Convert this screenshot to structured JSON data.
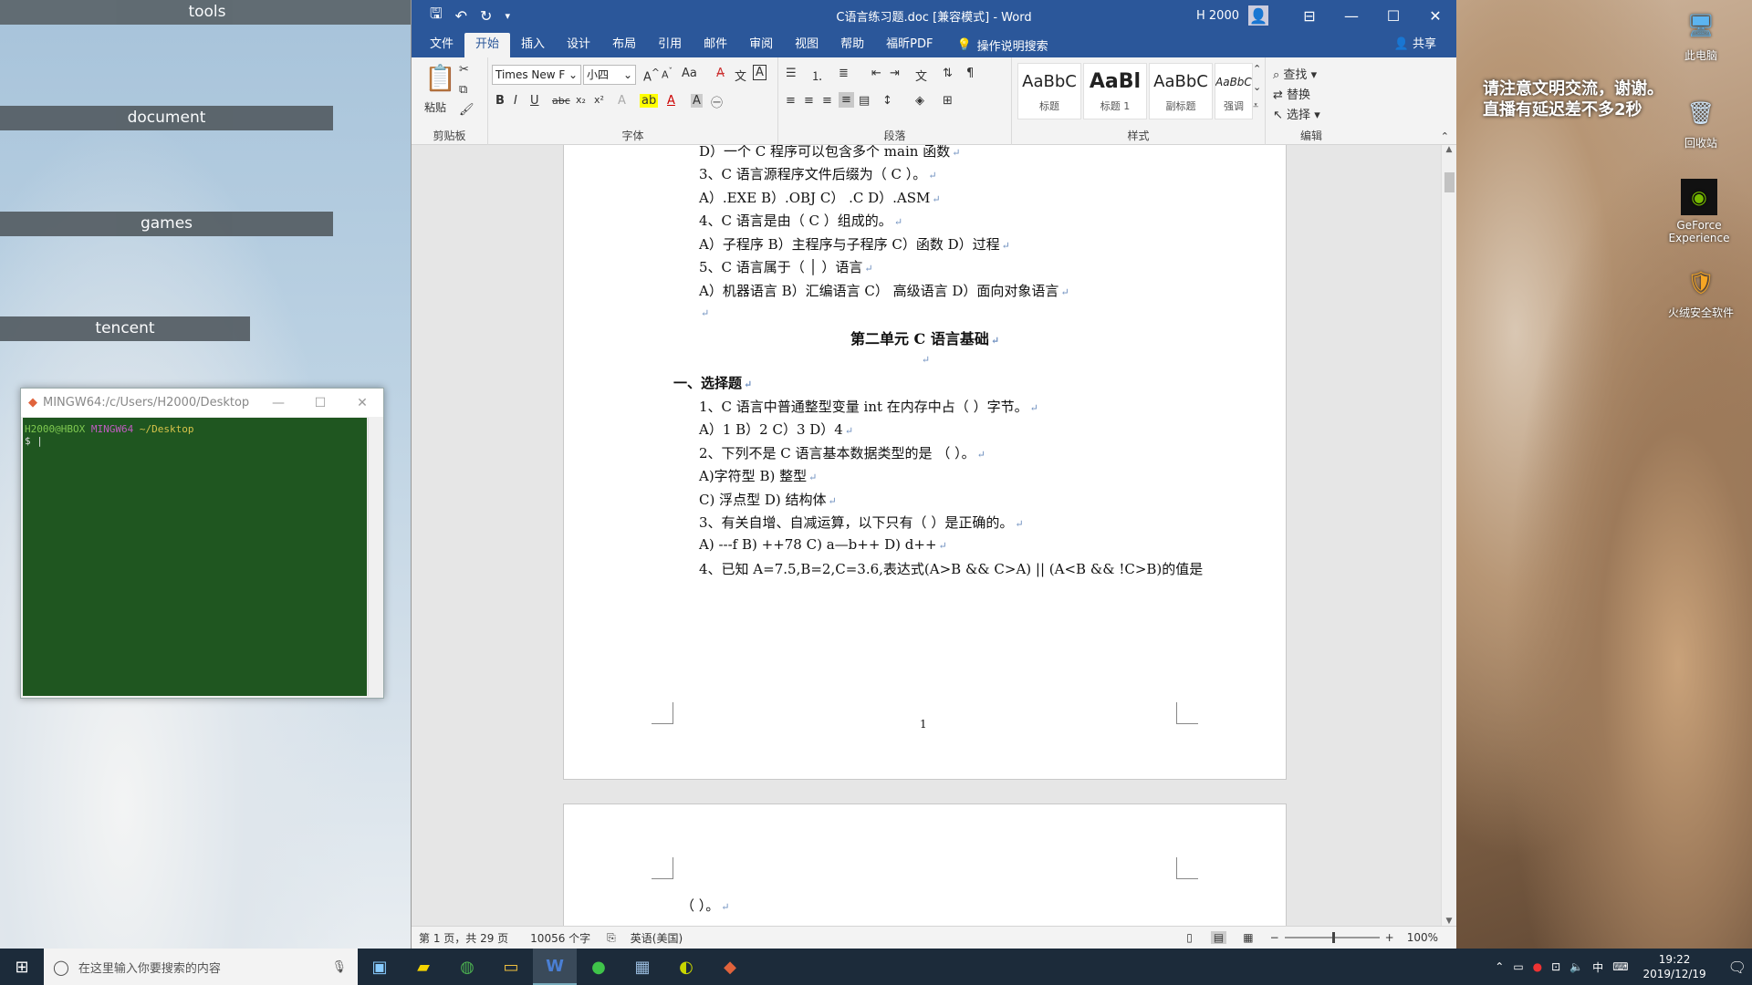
{
  "desktop": {
    "folders": [
      "tools",
      "document",
      "games",
      "tencent"
    ],
    "icons": [
      {
        "label": "此电脑",
        "icon": "computer-icon"
      },
      {
        "label": "回收站",
        "icon": "recycle-bin-icon"
      },
      {
        "label": "GeForce Experience",
        "icon": "nvidia-icon"
      },
      {
        "label": "火绒安全软件",
        "icon": "shield-icon"
      }
    ],
    "overlay_text": [
      "请注意文明交流，谢谢。",
      "直播有延迟差不多2秒"
    ]
  },
  "terminal": {
    "title": "MINGW64:/c/Users/H2000/Desktop",
    "prompt_user": "H2000@HBOX",
    "prompt_env": "MINGW64",
    "prompt_path": "~/Desktop",
    "prompt_symbol": "$"
  },
  "word": {
    "title": "C语言练习题.doc [兼容模式] - Word",
    "user": "H 2000",
    "tabs": [
      "文件",
      "开始",
      "插入",
      "设计",
      "布局",
      "引用",
      "邮件",
      "审阅",
      "视图",
      "帮助",
      "福昕PDF"
    ],
    "active_tab": "开始",
    "tell_me": "操作说明搜索",
    "share": "共享",
    "ribbon": {
      "clipboard": {
        "paste": "粘贴",
        "group": "剪贴板"
      },
      "font": {
        "name": "Times New F",
        "size": "小四",
        "group": "字体",
        "aa": "Aa",
        "grow": "A^",
        "shrink": "A^"
      },
      "paragraph": {
        "group": "段落"
      },
      "styles": {
        "group": "样式",
        "tiles": [
          {
            "sample": "AaBbC",
            "name": "标题"
          },
          {
            "sample": "AaBl",
            "name": "标题 1"
          },
          {
            "sample": "AaBbC",
            "name": "副标题"
          },
          {
            "sample": "AaBbCcDı",
            "name": "强调"
          }
        ]
      },
      "editing": {
        "group": "编辑",
        "find": "查找",
        "replace": "替换",
        "select": "选择"
      }
    },
    "document": {
      "lines": [
        "D）一个 C 程序可以包含多个 main 函数",
        "3、C  语言源程序文件后缀为（   C  ）。",
        "A）.EXE          B）.OBJ                  C）  .C        D）.ASM",
        "4、C 语言是由（  C  ）组成的。",
        "A）子程序       B）主程序与子程序      C）函数     D）过程",
        "5、C 语言属于（   │ ）语言",
        "A）机器语言    B）汇编语言    C）  高级语言     D）面向对象语言",
        "",
        "第二单元      C 语言基础",
        "",
        "一、选择题",
        "1、C 语言中普通整型变量 int 在内存中占（    ）字节。",
        "A）1                B）2                C）3                D）4",
        "2、下列不是 C 语言基本数据类型的是  （    ）。",
        "A)字符型                                    B)  整型",
        "C)  浮点型                                  D)  结构体",
        "3、有关自增、自减运算，以下只有（    ）是正确的。",
        "A) ---f            B) ++78            C) a—b++              D) d++",
        "4、已知 A=7.5,B=2,C=3.6,表达式(A>B  &&  C>A)  || (A<B  &&  !C>B)的值是"
      ],
      "page_number": "1",
      "page2_line": "（   ）。"
    },
    "status": {
      "page": "第 1 页，共 29 页",
      "words": "10056 个字",
      "lang": "英语(美国)",
      "zoom": "100%"
    }
  },
  "taskbar": {
    "search_placeholder": "在这里输入你要搜索的内容",
    "apps": [
      "task-view-icon",
      "sticky-notes-icon",
      "chrome-icon",
      "folder-icon",
      "word-icon",
      "wechat-icon",
      "calculator-icon",
      "browser-icon",
      "git-icon"
    ],
    "ime": "中",
    "time": "19:22",
    "date": "2019/12/19"
  }
}
